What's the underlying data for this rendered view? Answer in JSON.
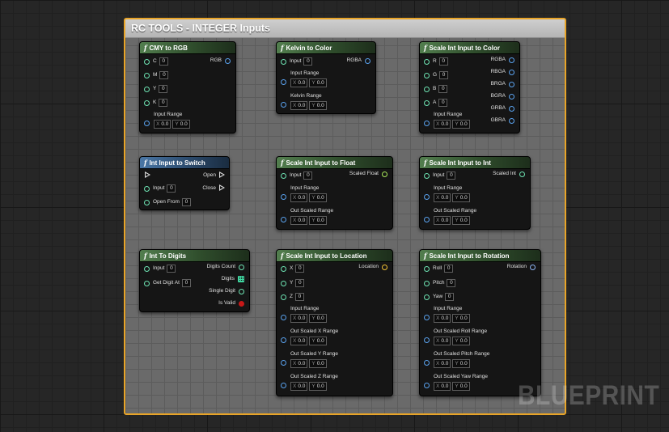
{
  "comment_title": "RC TOOLS - INTEGER Inputs",
  "watermark": "BLUEPRINT",
  "function_glyph": "f",
  "axis": {
    "x": "X",
    "y": "Y"
  },
  "nodes": {
    "cmy": {
      "title": "CMY to RGB",
      "inputs": [
        {
          "label": "C",
          "value": "0"
        },
        {
          "label": "M",
          "value": "0"
        },
        {
          "label": "Y",
          "value": "0"
        },
        {
          "label": "K",
          "value": "0"
        }
      ],
      "outputs": [
        "RGB"
      ],
      "ranges": [
        {
          "label": "Input Range",
          "x": "0.0",
          "y": "0.0"
        }
      ]
    },
    "kelvin": {
      "title": "Kelvin to Color",
      "inputs": [
        {
          "label": "Input",
          "value": "0"
        }
      ],
      "outputs": [
        "RGBA"
      ],
      "ranges": [
        {
          "label": "Input Range",
          "x": "0.0",
          "y": "0.0"
        },
        {
          "label": "Kelvin Range",
          "x": "0.0",
          "y": "0.0"
        }
      ]
    },
    "scale_color": {
      "title": "Scale Int Input to Color",
      "inputs": [
        {
          "label": "R",
          "value": "0"
        },
        {
          "label": "G",
          "value": "0"
        },
        {
          "label": "B",
          "value": "0"
        },
        {
          "label": "A",
          "value": "0"
        }
      ],
      "outputs": [
        "RGBA",
        "RBGA",
        "BRGA",
        "BGRA",
        "GRBA",
        "GBRA"
      ],
      "ranges": [
        {
          "label": "Input Range",
          "x": "0.0",
          "y": "0.0"
        }
      ]
    },
    "switch": {
      "title": "Int Input to Switch",
      "inputs": [
        {
          "label": "Input",
          "value": "0"
        },
        {
          "label": "Open From",
          "value": "0"
        }
      ],
      "outputs": [
        "Open",
        "Close"
      ]
    },
    "scale_float": {
      "title": "Scale Int Input to Float",
      "inputs": [
        {
          "label": "Input",
          "value": "0"
        }
      ],
      "outputs": [
        "Scaled Float"
      ],
      "ranges": [
        {
          "label": "Input Range",
          "x": "0.0",
          "y": "0.0"
        },
        {
          "label": "Out Scaled Range",
          "x": "0.0",
          "y": "0.0"
        }
      ]
    },
    "scale_int": {
      "title": "Scale Int Input to Int",
      "inputs": [
        {
          "label": "Input",
          "value": "0"
        }
      ],
      "outputs": [
        "Scaled Int"
      ],
      "ranges": [
        {
          "label": "Input Range",
          "x": "0.0",
          "y": "0.0"
        },
        {
          "label": "Out Scaled Range",
          "x": "0.0",
          "y": "0.0"
        }
      ]
    },
    "digits": {
      "title": "Int To Digits",
      "inputs": [
        {
          "label": "Input",
          "value": "0"
        },
        {
          "label": "Get Digit At",
          "value": "0"
        }
      ],
      "outputs": [
        "Digits Count",
        "Digits",
        "Single Digit",
        "Is Valid"
      ]
    },
    "location": {
      "title": "Scale Int Input to Location",
      "inputs": [
        {
          "label": "X",
          "value": "0"
        },
        {
          "label": "Y",
          "value": "0"
        },
        {
          "label": "Z",
          "value": "0"
        }
      ],
      "outputs": [
        "Location"
      ],
      "ranges": [
        {
          "label": "Input Range",
          "x": "0.0",
          "y": "0.0"
        },
        {
          "label": "Out Scaled X Range",
          "x": "0.0",
          "y": "0.0"
        },
        {
          "label": "Out Scaled Y Range",
          "x": "0.0",
          "y": "0.0"
        },
        {
          "label": "Out Scaled Z Range",
          "x": "0.0",
          "y": "0.0"
        }
      ]
    },
    "rotation": {
      "title": "Scale Int Input to Rotation",
      "inputs": [
        {
          "label": "Roll",
          "value": "0"
        },
        {
          "label": "Pitch",
          "value": "0"
        },
        {
          "label": "Yaw",
          "value": "0"
        }
      ],
      "outputs": [
        "Rotation"
      ],
      "ranges": [
        {
          "label": "Input Range",
          "x": "0.0",
          "y": "0.0"
        },
        {
          "label": "Out Scaled Roll Range",
          "x": "0.0",
          "y": "0.0"
        },
        {
          "label": "Out Scaled Pitch Range",
          "x": "0.0",
          "y": "0.0"
        },
        {
          "label": "Out Scaled Yaw Range",
          "x": "0.0",
          "y": "0.0"
        }
      ]
    }
  },
  "colors": {
    "comment_border": "#e8a428",
    "pure_header": "#527e4e",
    "impure_header": "#4a77a6",
    "int_pin": "#6ee4b3",
    "struct_pin": "#5aa2ee",
    "vector_pin": "#f1c232",
    "bool_pin": "#c81818"
  },
  "icons": {
    "function": "function-icon",
    "exec": "exec-pin-icon",
    "int": "int-pin-icon",
    "struct": "struct-pin-icon",
    "array": "array-pin-icon",
    "bool": "bool-pin-icon"
  }
}
